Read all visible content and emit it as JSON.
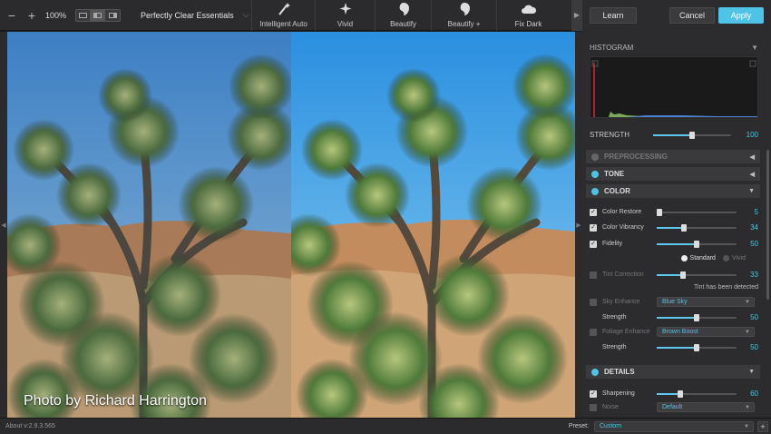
{
  "toolbar": {
    "zoom_minus": "−",
    "zoom_plus": "+",
    "zoom": "100%",
    "preset_name": "Perfectly Clear Essentials",
    "presets": [
      {
        "label": "Intelligent Auto",
        "icon": "wand-icon"
      },
      {
        "label": "Vivid",
        "icon": "sparkle-icon"
      },
      {
        "label": "Beautify",
        "icon": "face-icon"
      },
      {
        "label": "Beautify +",
        "icon": "face-plus-icon"
      },
      {
        "label": "Fix Dark",
        "icon": "cloud-icon"
      }
    ]
  },
  "actions": {
    "learn": "Learn",
    "cancel": "Cancel",
    "apply": "Apply"
  },
  "image": {
    "credit": "Photo by Richard Harrington"
  },
  "histogram": {
    "title": "HISTOGRAM"
  },
  "strength": {
    "label": "STRENGTH",
    "value": 100,
    "fraction": 0.5
  },
  "sections": {
    "preprocessing": "PREPROCESSING",
    "tone": "TONE",
    "color": "COLOR",
    "details": "DETAILS"
  },
  "color": {
    "color_restore": {
      "label": "Color Restore",
      "value": 5,
      "fraction": 0.03
    },
    "color_vibrancy": {
      "label": "Color Vibrancy",
      "value": 34,
      "fraction": 0.34
    },
    "fidelity": {
      "label": "Fidelity",
      "value": 50,
      "fraction": 0.5
    },
    "mode_standard": "Standard",
    "mode_vivid": "Vivid",
    "tint_correction": {
      "label": "Tint Correction",
      "value": 33,
      "fraction": 0.33
    },
    "tint_note": "Tint has been detected",
    "sky_enhance": {
      "label": "Sky Enhance",
      "option": "Blue Sky"
    },
    "sky_strength": {
      "label": "Strength",
      "value": 50,
      "fraction": 0.5
    },
    "foliage_enhance": {
      "label": "Foliage Enhance",
      "option": "Brown Boost"
    },
    "foliage_strength": {
      "label": "Strength",
      "value": 50,
      "fraction": 0.5
    }
  },
  "details": {
    "sharpening": {
      "label": "Sharpening",
      "value": 60,
      "fraction": 0.3
    },
    "noise": {
      "label": "Noise",
      "option": "Default"
    }
  },
  "status": {
    "about": "About v:2.9.3.565",
    "preset_label": "Preset:",
    "preset_value": "Custom",
    "add": "+"
  },
  "colors": {
    "accent": "#4fc3e6",
    "panel": "#2c2c2e",
    "toolbar": "#2b2b2d"
  }
}
